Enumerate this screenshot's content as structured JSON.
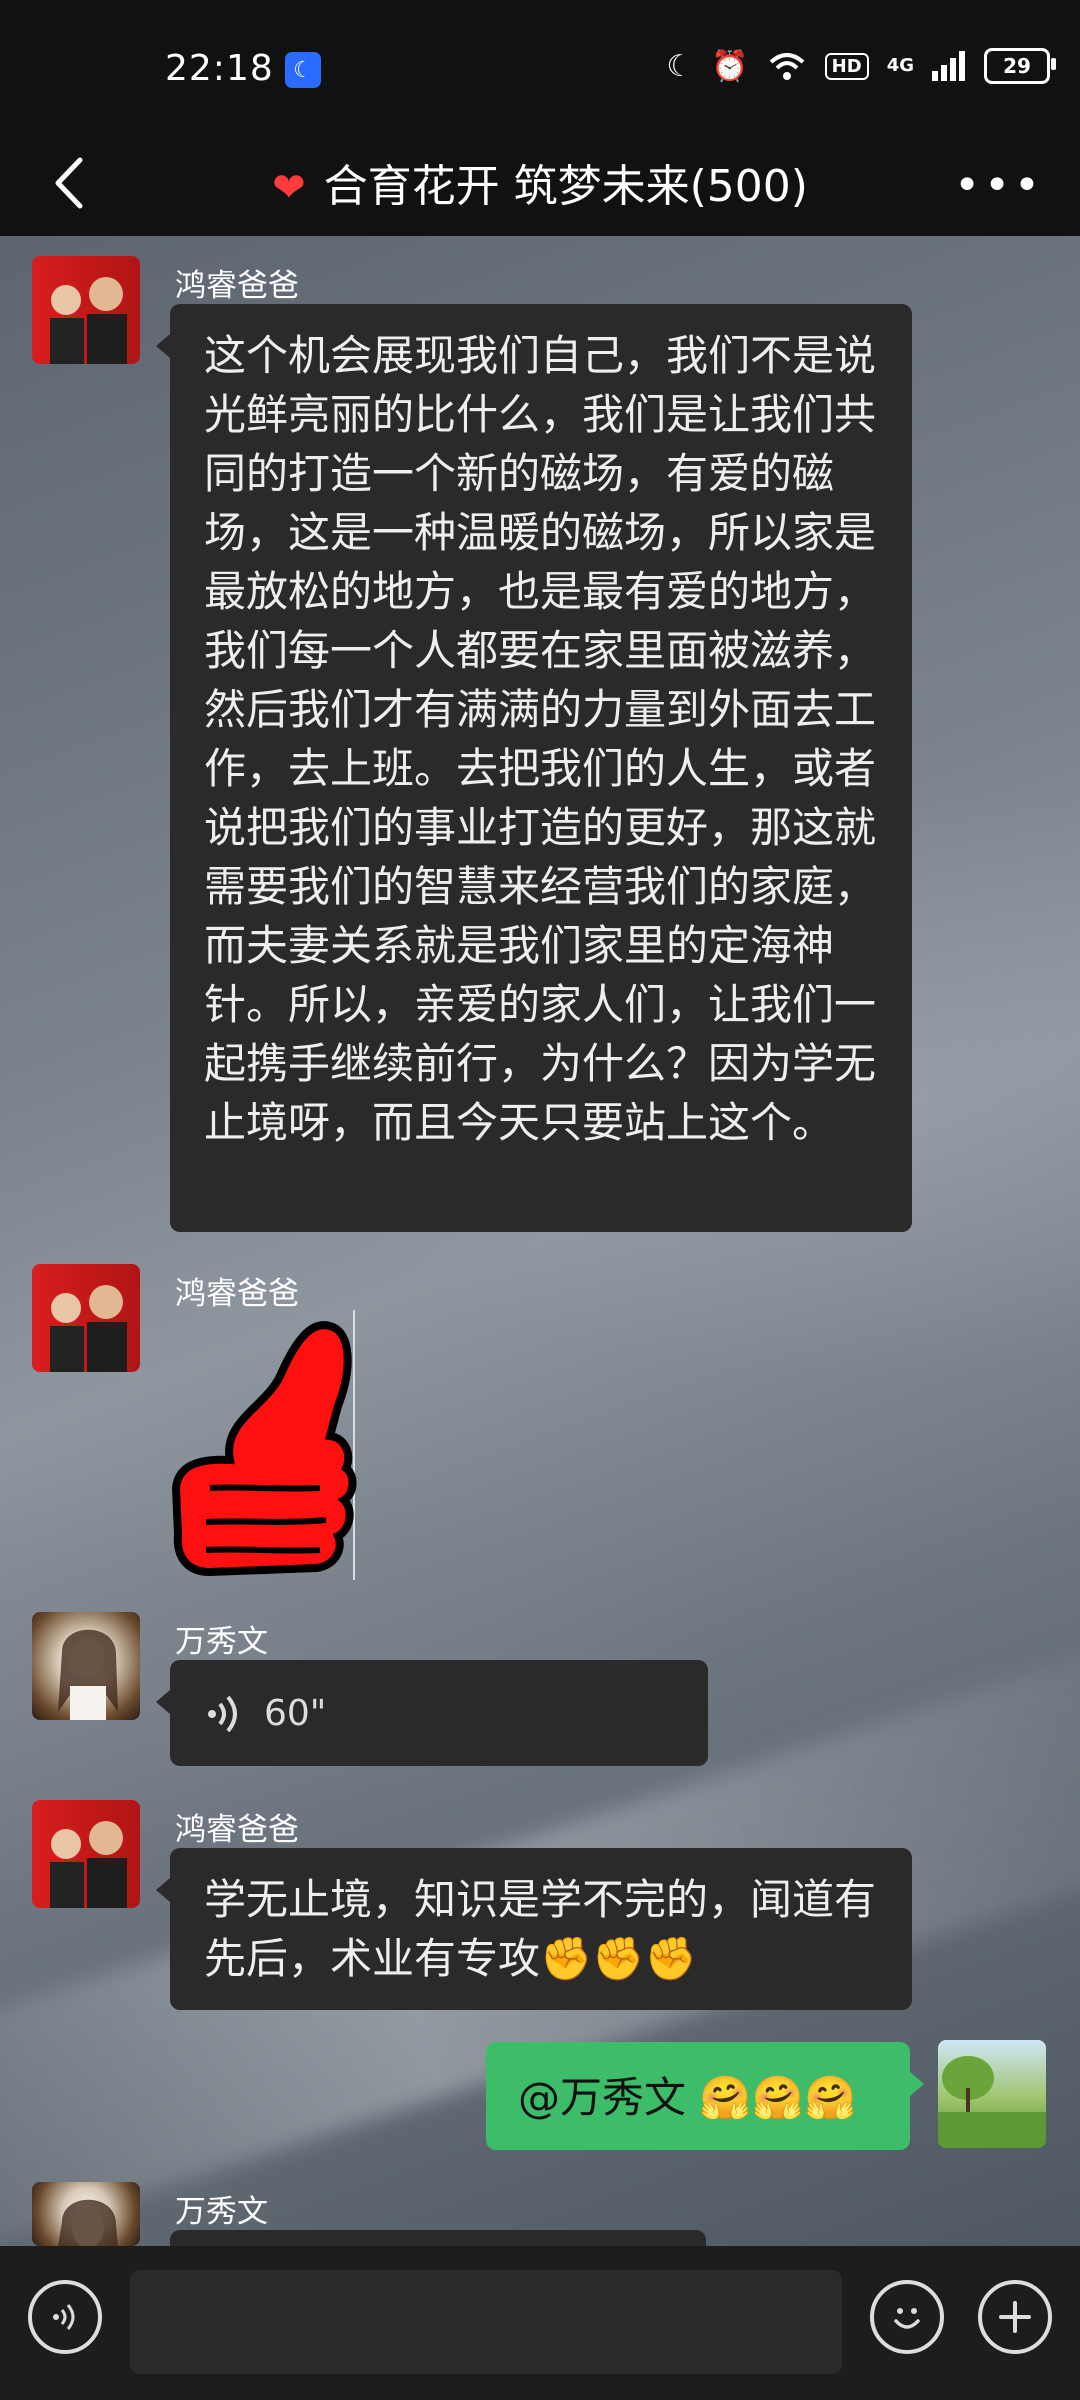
{
  "status_bar": {
    "time": "22:18",
    "hd": "HD",
    "net": "4G",
    "battery": "29"
  },
  "header": {
    "title": "合育花开 筑梦未来(500)"
  },
  "messages": [
    {
      "sender": "鸿睿爸爸",
      "text": "这个机会展现我们自己，我们不是说光鲜亮丽的比什么，我们是让我们共同的打造一个新的磁场，有爱的磁场，这是一种温暖的磁场，所以家是最放松的地方，也是最有爱的地方，我们每一个人都要在家里面被滋养，然后我们才有满满的力量到外面去工作，去上班。去把我们的人生，或者说把我们的事业打造的更好，那这就需要我们的智慧来经营我们的家庭，而夫妻关系就是我们家里的定海神针。所以，亲爱的家人们，让我们一起携手继续前行，为什么？因为学无止境呀，而且今天只要站上这个。"
    },
    {
      "sender": "鸿睿爸爸"
    },
    {
      "sender": "万秀文",
      "voice_duration": "60\""
    },
    {
      "sender": "鸿睿爸爸",
      "text": "学无止境，知识是学不完的，闻道有先后，术业有专攻✊✊✊"
    },
    {
      "text": "@万秀文 🤗🤗🤗"
    },
    {
      "sender": "万秀文"
    }
  ]
}
